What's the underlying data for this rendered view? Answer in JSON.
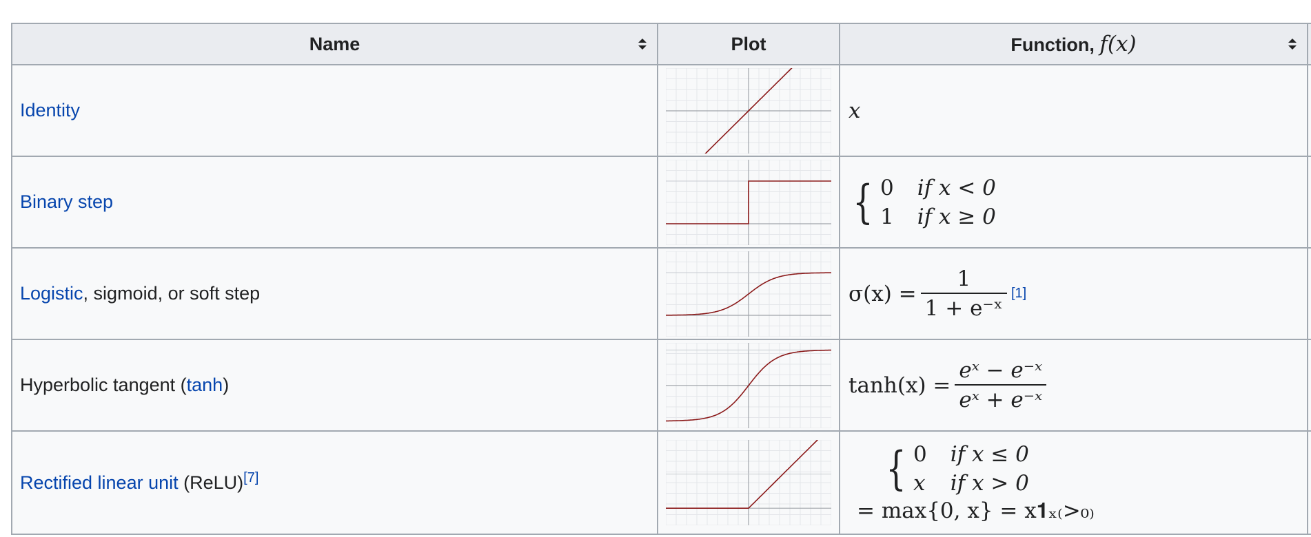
{
  "table": {
    "headers": {
      "name": "Name",
      "plot": "Plot",
      "function_prefix": "Function, ",
      "function_math": "f(x)"
    },
    "rows": [
      {
        "name_link": "Identity",
        "function": "x"
      },
      {
        "name_link": "Binary step",
        "cases": [
          [
            "0",
            "if x < 0"
          ],
          [
            "1",
            "if x ≥ 0"
          ]
        ]
      },
      {
        "name_link": "Logistic",
        "name_rest": ", sigmoid, or soft step",
        "function_lhs": "σ(x) =",
        "function_num": "1",
        "function_den": "1 + e⁻ˣ",
        "ref": "[1]"
      },
      {
        "name_pre": "Hyperbolic tangent (",
        "name_link": "tanh",
        "name_post": ")",
        "function_lhs": "tanh(x) =",
        "function_num": "eˣ − e⁻ˣ",
        "function_den": "eˣ + e⁻ˣ"
      },
      {
        "name_link": "Rectified linear unit",
        "name_rest": " (ReLU)",
        "ref": "[7]",
        "cases": [
          [
            "0",
            "if x ≤ 0"
          ],
          [
            "x",
            "if x > 0"
          ]
        ],
        "function_line2": "= max{0, x} = x𝟏ₓ₍>₀₎"
      }
    ]
  },
  "colors": {
    "link": "#0645ad",
    "curve": "#8b1a1a",
    "header_bg": "#eaecf0",
    "cell_bg": "#f8f9fa",
    "border": "#a2a9b1"
  },
  "plots": [
    "identity",
    "binary-step",
    "logistic",
    "tanh",
    "relu"
  ]
}
